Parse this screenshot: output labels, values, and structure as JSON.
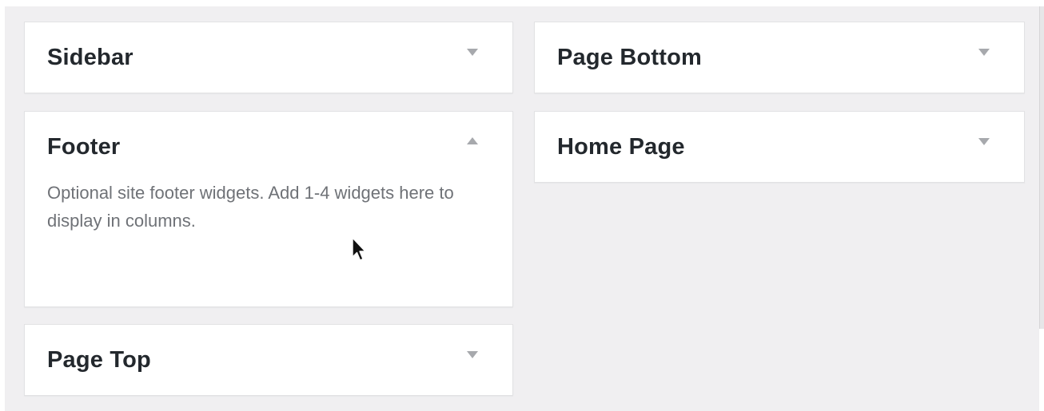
{
  "widget_areas": [
    {
      "title": "Sidebar",
      "expanded": false,
      "toggle_icon": "caret-down-icon"
    },
    {
      "title": "Footer",
      "expanded": true,
      "toggle_icon": "caret-up-icon",
      "description": "Optional site footer widgets. Add 1-4 widgets here to display in columns."
    },
    {
      "title": "Page Top",
      "expanded": false,
      "toggle_icon": "caret-down-icon"
    },
    {
      "title": "Page Bottom",
      "expanded": false,
      "toggle_icon": "caret-down-icon"
    },
    {
      "title": "Home Page",
      "expanded": false,
      "toggle_icon": "caret-down-icon"
    }
  ],
  "colors": {
    "background": "#f0eff1",
    "panel": "#ffffff",
    "title": "#23282d",
    "description": "#6f7277",
    "caret": "#a7a9ad"
  },
  "cursor_icon": "mouse-pointer-icon"
}
